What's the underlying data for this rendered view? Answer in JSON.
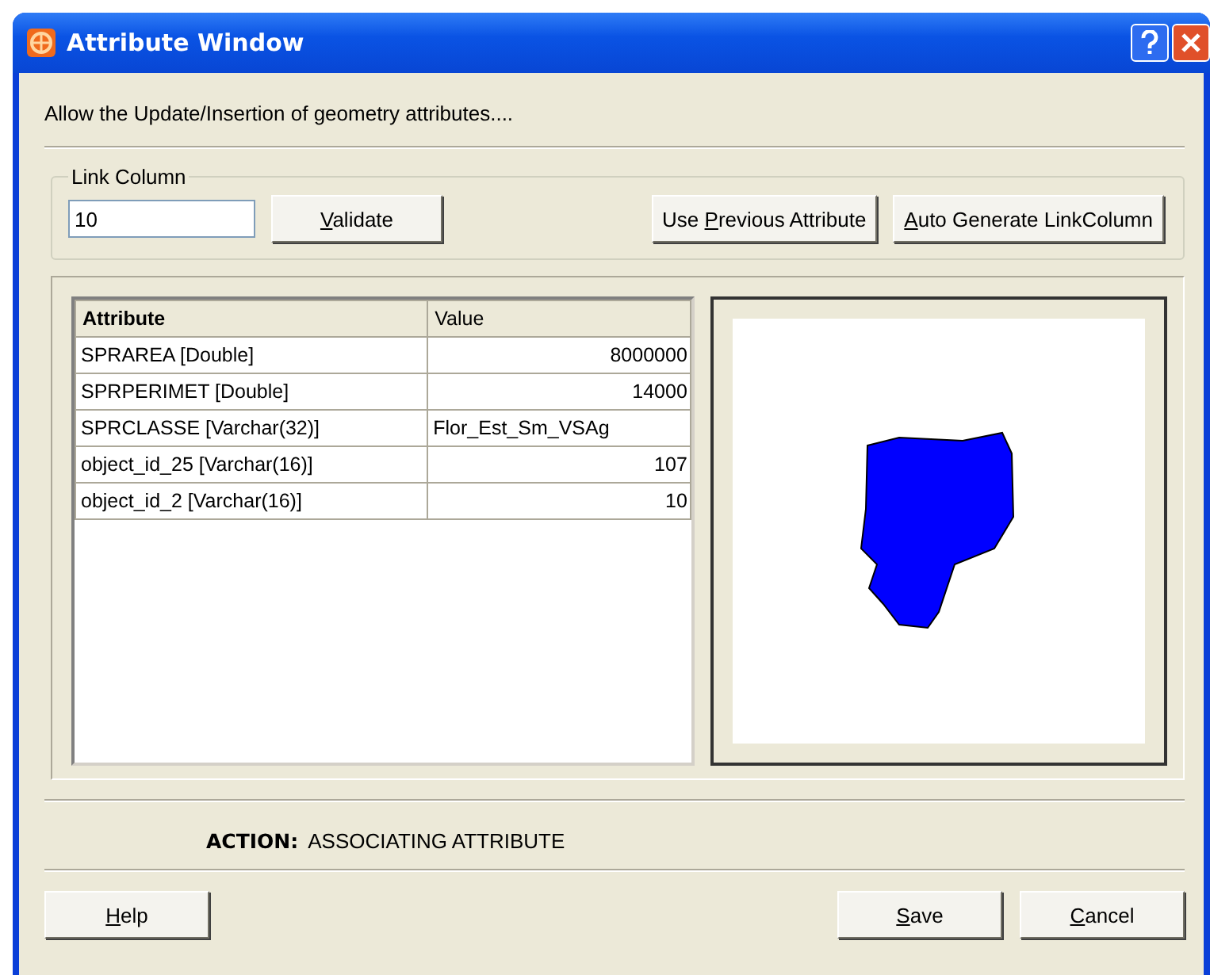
{
  "window": {
    "title": "Attribute Window"
  },
  "description": "Allow the Update/Insertion of geometry attributes....",
  "link_column": {
    "legend": "Link Column",
    "value": "10",
    "buttons": [
      {
        "key": "V",
        "after": "alidate"
      },
      {
        "before": "Use ",
        "key": "P",
        "after": "revious Attribute"
      },
      {
        "key": "A",
        "after": "uto Generate LinkColumn"
      }
    ]
  },
  "table": {
    "columns": [
      "Attribute",
      "Value"
    ],
    "rows": [
      {
        "attribute": "SPRAREA [Double]",
        "value": "8000000",
        "kind": "number"
      },
      {
        "attribute": "SPRPERIMET [Double]",
        "value": "14000",
        "kind": "number"
      },
      {
        "attribute": "SPRCLASSE [Varchar(32)]",
        "value": "Flor_Est_Sm_VSAg",
        "kind": "text"
      },
      {
        "attribute": "object_id_25 [Varchar(16)]",
        "value": "107",
        "kind": "number"
      },
      {
        "attribute": "object_id_2 [Varchar(16)]",
        "value": "10",
        "kind": "number"
      }
    ]
  },
  "action": {
    "label": "ACTION:",
    "value": "ASSOCIATING ATTRIBUTE"
  },
  "footer_left": [
    {
      "key": "H",
      "after": "elp"
    }
  ],
  "footer_right": [
    {
      "key": "S",
      "after": "ave"
    },
    {
      "key": "C",
      "after": "ancel"
    }
  ]
}
